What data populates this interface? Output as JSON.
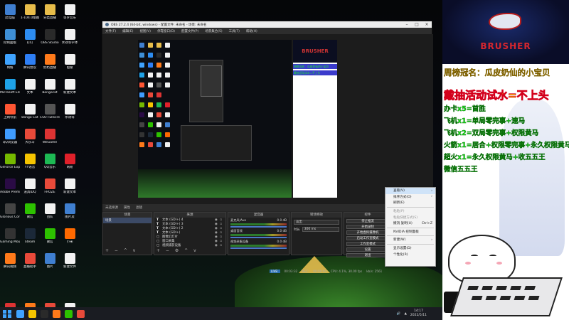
{
  "desktop": {
    "icons": [
      {
        "label": "此电脑",
        "color": "#3f7fd0"
      },
      {
        "label": "1-104.0端图",
        "color": "#e8bd4a"
      },
      {
        "label": "分类直播",
        "color": "#e8bd4a"
      },
      {
        "label": "等罗音乐",
        "color": "#f2f2f2"
      },
      {
        "label": "控制面板",
        "color": "#3e8fd6"
      },
      {
        "label": "钉钉",
        "color": "#2d8cf0"
      },
      {
        "label": "OBS Studio",
        "color": "#2a2a2a"
      },
      {
        "label": "水效等字体",
        "color": "#f2f2f2"
      },
      {
        "label": "网络",
        "color": "#3fa3ff"
      },
      {
        "label": "腾讯会议",
        "color": "#2e7ff5"
      },
      {
        "label": "奶奶直播",
        "color": "#ff7a1a"
      },
      {
        "label": "超级",
        "color": "#f2f2f2"
      },
      {
        "label": "Microsoft Edge",
        "color": "#1ea2e8"
      },
      {
        "label": "文本",
        "color": "#f2f2f2"
      },
      {
        "label": "Bongocat",
        "color": "#f2f2f2"
      },
      {
        "label": "新建文本",
        "color": "#f2f2f2"
      },
      {
        "label": "上网导航",
        "color": "#ff5533"
      },
      {
        "label": "Bongo Cat",
        "color": "#f2f2f2"
      },
      {
        "label": "CSO Fullscreen",
        "color": "#555"
      },
      {
        "label": "水效等",
        "color": "#f2f2f2"
      },
      {
        "label": "QQ浏览器",
        "color": "#3f9cff"
      },
      {
        "label": "大乐斗",
        "color": "#e84a3a"
      },
      {
        "label": "WeGame",
        "color": "#d33"
      },
      {
        "label": "",
        "color": "transparent"
      },
      {
        "label": "GeForce Experience",
        "color": "#76b900"
      },
      {
        "label": "YY语音",
        "color": "#f5c400"
      },
      {
        "label": "QQ音乐",
        "color": "#1db954"
      },
      {
        "label": "网易",
        "color": "#e0202a"
      },
      {
        "label": "Adobe Premiere",
        "color": "#2a0b45"
      },
      {
        "label": "道具IDQ",
        "color": "#f2f2f2"
      },
      {
        "label": "FROZE",
        "color": "#e84a3a"
      },
      {
        "label": "新建文本",
        "color": "#f2f2f2"
      },
      {
        "label": "Glorious Core",
        "color": "#444"
      },
      {
        "label": "微信",
        "color": "#2dc100"
      },
      {
        "label": "团队",
        "color": "#f2f2f2"
      },
      {
        "label": "图片及",
        "color": "#3f7fd0"
      },
      {
        "label": "Gaming Mouse",
        "color": "#333"
      },
      {
        "label": "Steam",
        "color": "#1b2838"
      },
      {
        "label": "微信",
        "color": "#2dc100"
      },
      {
        "label": "小米",
        "color": "#ff6900"
      },
      {
        "label": "腾讯视频",
        "color": "#ff7a1a"
      },
      {
        "label": "直播助手",
        "color": "#e84a3a"
      },
      {
        "label": "图片",
        "color": "#3f7fd0"
      },
      {
        "label": "新建文件",
        "color": "#f2f2f2"
      },
      {
        "label": "",
        "color": "transparent"
      },
      {
        "label": "",
        "color": "transparent"
      },
      {
        "label": "",
        "color": "transparent"
      },
      {
        "label": "",
        "color": "transparent"
      },
      {
        "label": "WPS Office",
        "color": "#d33"
      },
      {
        "label": "斗鱼直播伴侣",
        "color": "#ff7a1a"
      },
      {
        "label": "wu",
        "color": "#e84a3a"
      },
      {
        "label": "文字文档",
        "color": "#f2f2f2"
      }
    ]
  },
  "obs": {
    "title": "OBS 27.2.4 (64-bit, windows) - 配置文件: 未命名 - 场景: 未命名",
    "menu": [
      "文件(F)",
      "编辑(E)",
      "视图(V)",
      "停靠窗口(D)",
      "配置文件(P)",
      "场景集合(S)",
      "工具(T)",
      "帮助(H)"
    ],
    "dock_tabs": [
      "未选择源",
      "属性",
      "滤镜"
    ],
    "scenes": {
      "header": "场景",
      "items": [
        "场景"
      ]
    },
    "sources": {
      "header": "来源",
      "items": [
        {
          "type": "T",
          "name": "文本 (GDI+) 4"
        },
        {
          "type": "T",
          "name": "文本 (GDI+) 3"
        },
        {
          "type": "T",
          "name": "文本 (GDI+) 2"
        },
        {
          "type": "T",
          "name": "文本 (GDI+)"
        },
        {
          "type": "▢",
          "name": "图像幻灯片"
        },
        {
          "type": "▢",
          "name": "窗口采集"
        },
        {
          "type": "▢",
          "name": "视频捕获设备"
        }
      ]
    },
    "mixer": {
      "header": "混音器",
      "channels": [
        {
          "name": "麦克风/Aux",
          "level": "0.0 dB"
        },
        {
          "name": "桌面音频",
          "level": "0.0 dB"
        },
        {
          "name": "视频采集设备",
          "level": "0.0 dB"
        }
      ]
    },
    "transitions": {
      "header": "转场特效",
      "type": "淡出",
      "duration_label": "时长",
      "duration": "300 ms"
    },
    "controls": {
      "header": "控件",
      "buttons": [
        "停止推流",
        "开始录制",
        "开始虚拟摄像机",
        "启动工作室模式",
        "工作室模式",
        "设置",
        "退出"
      ]
    },
    "status": {
      "live_label": "LIVE:",
      "live_time": "00:03:32",
      "rec_label": "REC:",
      "rec_time": "00:00:00",
      "cpu": "CPU: 4.1%, 30.00 fps",
      "kbps": "kb/s: 2561"
    }
  },
  "context_menu": {
    "items": [
      {
        "label": "查看(V)",
        "arrow": "›",
        "disabled": false,
        "hl": true
      },
      {
        "label": "排序方式(O)",
        "arrow": "›",
        "disabled": false
      },
      {
        "label": "刷新(E)",
        "arrow": "",
        "disabled": false
      },
      {
        "label": "粘贴(P)",
        "arrow": "",
        "disabled": true
      },
      {
        "label": "粘贴快捷方式(S)",
        "arrow": "",
        "disabled": true
      },
      {
        "label": "撤消 复制(U)",
        "arrow": "Ctrl+Z",
        "disabled": false
      },
      {
        "label": "NVIDIA 控制面板",
        "arrow": "",
        "disabled": false
      },
      {
        "label": "新建(W)",
        "arrow": "›",
        "disabled": false
      },
      {
        "label": "显示设置(D)",
        "arrow": "",
        "disabled": false
      },
      {
        "label": "个性化(R)",
        "arrow": "",
        "disabled": false
      }
    ]
  },
  "taskbar": {
    "apps": [
      "#3fa3ff",
      "#f5c400",
      "#2a2a2a",
      "#ff7a1a",
      "#2dc100",
      "#e84a3a"
    ],
    "time": "14:17",
    "date": "2022/5/11"
  },
  "stream_overlay": {
    "brand": "BRUSHER",
    "lines": [
      "周榜冠名：瓜皮奶仙的小宝贝",
      "戴抽活动试水=不上头",
      "办卡x5=首胜",
      "飞机x1=单局零完事+速马",
      "飞机x2=双局零完事+权限黄马",
      "火箭x1=居合+权限零完事+永久权限黄马",
      "超火x1=永久权限黄马+收五五王",
      "微信五五王"
    ]
  }
}
